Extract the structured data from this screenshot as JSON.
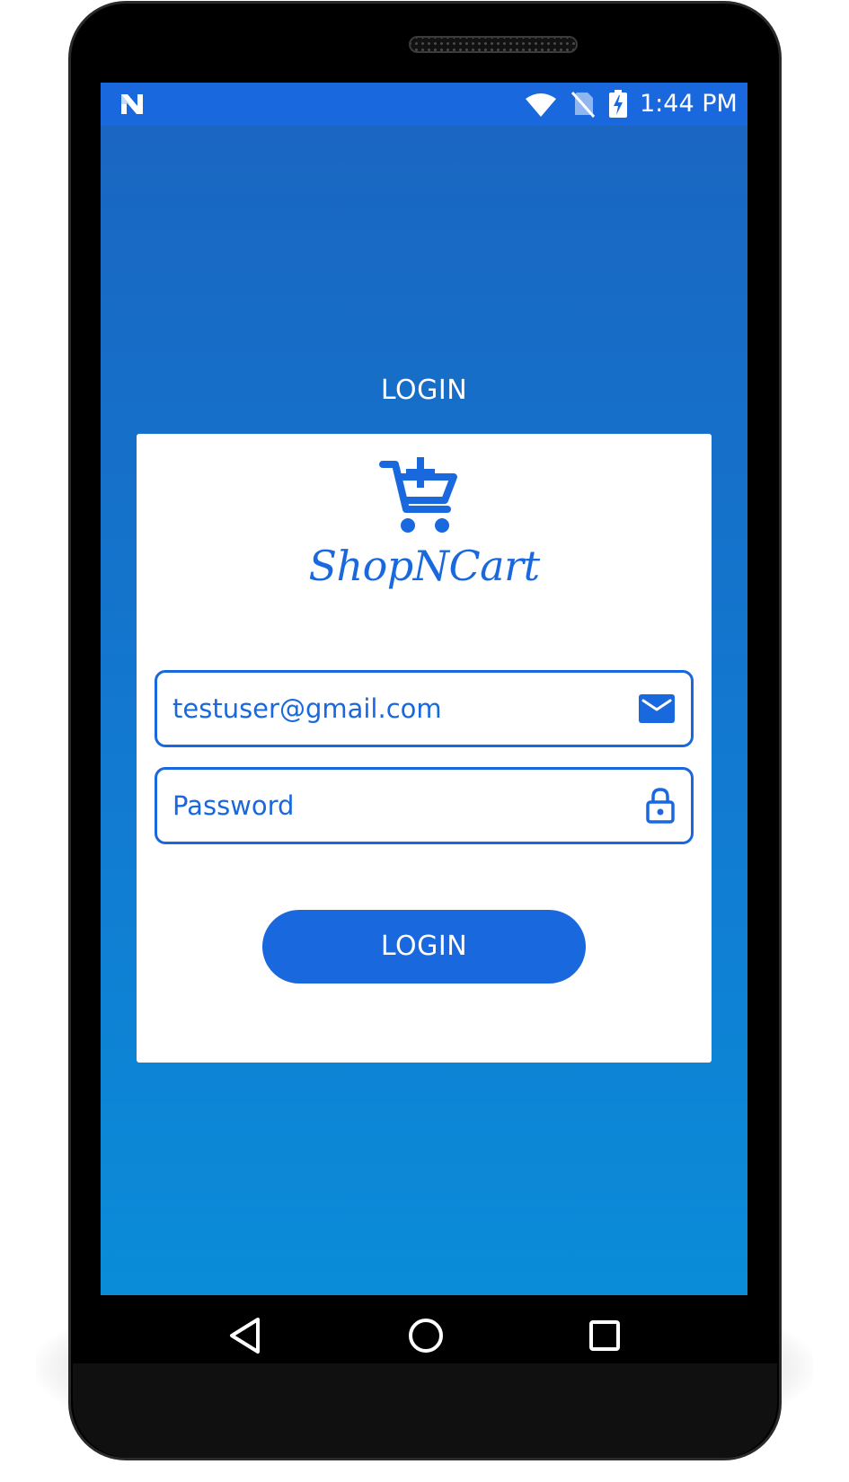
{
  "status_bar": {
    "time": "1:44 PM",
    "icons": [
      "notification-n-icon",
      "wifi-icon",
      "no-sim-icon",
      "battery-charging-icon"
    ]
  },
  "login_screen": {
    "title": "LOGIN",
    "brand_name": "ShopNCart",
    "logo_icon": "cart-plus-icon",
    "email_field": {
      "value": "testuser@gmail.com",
      "icon": "envelope-icon"
    },
    "password_field": {
      "placeholder": "Password",
      "icon": "lock-icon"
    },
    "login_button": "LOGIN"
  },
  "navigation_bar": {
    "items": [
      "back-icon",
      "home-icon",
      "recent-apps-icon"
    ]
  },
  "colors": {
    "accent": "#1a68de",
    "background_top": "#1a65c0",
    "background_bottom": "#0a8cd9",
    "card": "#ffffff"
  }
}
